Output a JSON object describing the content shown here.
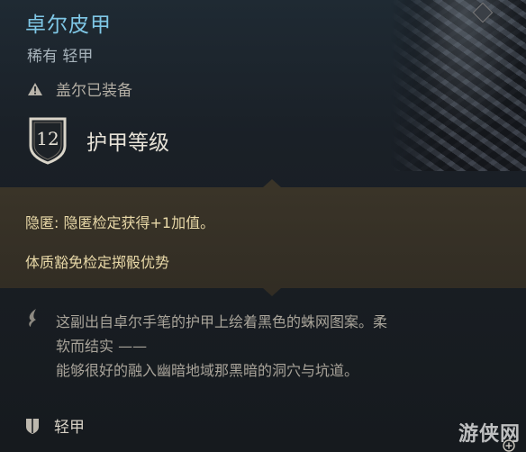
{
  "item": {
    "name": "卓尔皮甲",
    "subtitle": "稀有 轻甲",
    "equipped_by": "盖尔已装备",
    "armor_class": {
      "value": "12",
      "label": "护甲等级"
    },
    "properties": [
      "隐匿: 隐匿检定获得+1加值。",
      "体质豁免检定掷骰优势"
    ],
    "description": [
      "这副出自卓尔手笔的护甲上绘着黑色的蛛网图案。柔",
      "软而结实 ——",
      "能够很好的融入幽暗地域那黑暗的洞穴与坑道。"
    ],
    "armor_type": "轻甲"
  },
  "watermark": "游侠网",
  "colors": {
    "title": "#7fc7e6",
    "property_text": "#e9d9a8",
    "property_band": "#3a3428"
  },
  "icons": [
    "warning-icon",
    "armor-class-shield-icon",
    "description-quill-icon",
    "light-armor-icon",
    "plus-icon"
  ]
}
